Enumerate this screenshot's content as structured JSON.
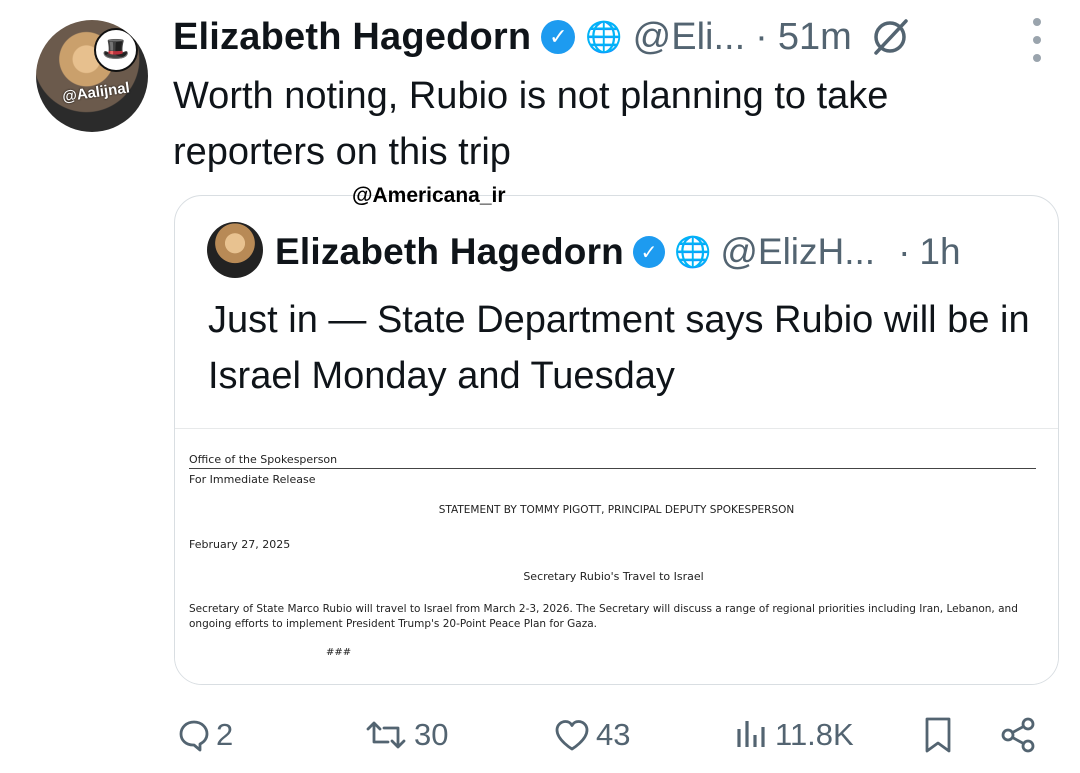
{
  "tweet": {
    "author_name": "Elizabeth Hagedorn",
    "handle": "@Eli...",
    "separator": "·",
    "time": "51m",
    "text": "Worth noting, Rubio is not planning to take reporters on this trip",
    "avatar_watermark": "@Aalijnal"
  },
  "watermark": "@Americana_ir",
  "quoted": {
    "author_name": "Elizabeth Hagedorn",
    "handle": "@ElizH...",
    "separator": "·",
    "time": "1h",
    "text": "Just in — State Department says Rubio will be in Israel Monday and Tuesday",
    "document": {
      "office": "Office of the Spokesperson",
      "release": "For Immediate Release",
      "statement": "STATEMENT BY TOMMY PIGOTT, PRINCIPAL DEPUTY SPOKESPERSON",
      "date": "February 27, 2025",
      "title": "Secretary Rubio's Travel to Israel",
      "body": "Secretary of State Marco Rubio will travel to Israel from March 2-3, 2026.  The Secretary will discuss a range of regional priorities including Iran, Lebanon, and ongoing efforts to implement President Trump's 20-Point Peace Plan for Gaza.",
      "end_mark": "###"
    }
  },
  "actions": {
    "replies": "2",
    "reposts": "30",
    "likes": "43",
    "views": "11.8K"
  },
  "icons": {
    "verified": "verified-badge-icon",
    "affiliation": "globe-icon",
    "mute": "mute-icon",
    "more": "more-icon",
    "reply": "reply-icon",
    "repost": "repost-icon",
    "like": "heart-icon",
    "views": "views-icon",
    "bookmark": "bookmark-icon",
    "share": "share-icon"
  },
  "colors": {
    "verified": "#1d9bf0",
    "muted_text": "#536471",
    "text": "#0f1419"
  }
}
